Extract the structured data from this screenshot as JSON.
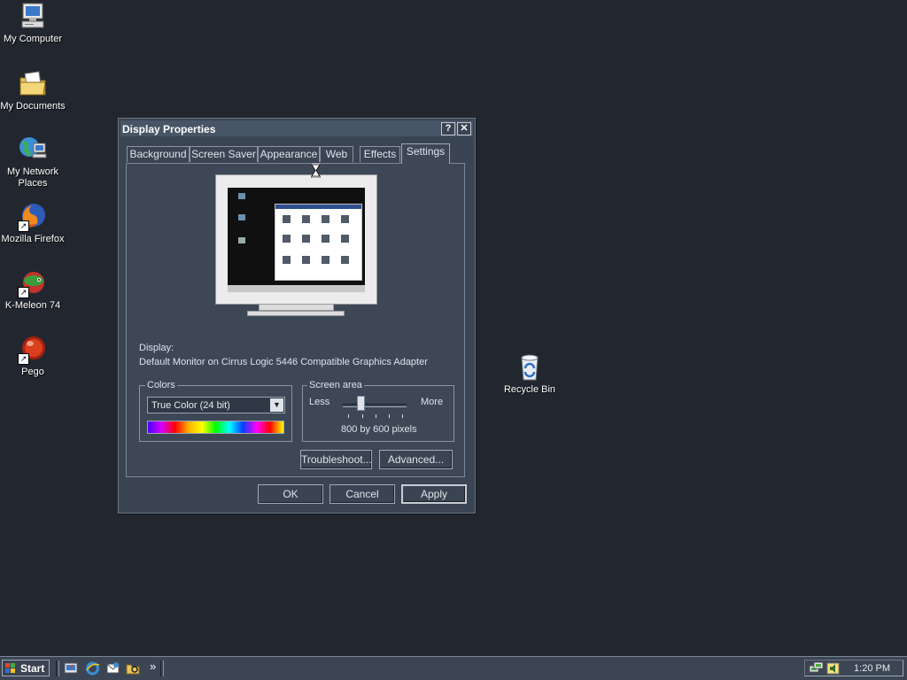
{
  "desktop": {
    "icons": [
      {
        "label": "My Computer"
      },
      {
        "label": "My Documents"
      },
      {
        "label": "My Network Places"
      },
      {
        "label": "Mozilla Firefox"
      },
      {
        "label": "K-Meleon 74"
      },
      {
        "label": "Pego"
      },
      {
        "label": "Recycle Bin"
      }
    ]
  },
  "window": {
    "title": "Display Properties",
    "help_glyph": "?",
    "close_glyph": "✕",
    "tabs": [
      "Background",
      "Screen Saver",
      "Appearance",
      "Web",
      "Effects",
      "Settings"
    ],
    "active_tab": "Settings",
    "display_label": "Display:",
    "display_value": "Default Monitor on Cirrus Logic 5446 Compatible Graphics Adapter",
    "colors": {
      "group_label": "Colors",
      "selected": "True Color (24 bit)",
      "dropdown_glyph": "▼"
    },
    "screen_area": {
      "group_label": "Screen area",
      "less_label": "Less",
      "more_label": "More",
      "value_text": "800 by 600 pixels",
      "slider_position": 0.25
    },
    "buttons": {
      "troubleshoot": "Troubleshoot...",
      "advanced": "Advanced...",
      "ok": "OK",
      "cancel": "Cancel",
      "apply": "Apply"
    }
  },
  "taskbar": {
    "start_label": "Start",
    "overflow_glyph": "»",
    "clock": "1:20 PM"
  },
  "colors": {
    "desktop": "#22272f",
    "window": "#3a4452",
    "titlebar": "#485566"
  }
}
